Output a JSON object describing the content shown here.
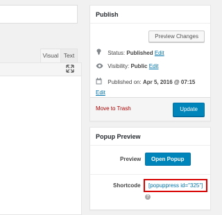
{
  "editor": {
    "tabs": {
      "visual": "Visual",
      "text": "Text"
    },
    "expand_icon": "fullscreen-icon"
  },
  "publish": {
    "title": "Publish",
    "preview_label": "Preview Changes",
    "status_label": "Status:",
    "status_value": "Published",
    "visibility_label": "Visibility:",
    "visibility_value": "Public",
    "published_label": "Published on:",
    "published_value": "Apr 5, 2016 @ 07:15",
    "edit_label": "Edit",
    "trash_label": "Move to Trash",
    "update_label": "Update",
    "icons": {
      "status": "pin-icon",
      "visibility": "eye-icon",
      "date": "calendar-icon"
    }
  },
  "popup_preview": {
    "title": "Popup Preview",
    "preview_label": "Preview",
    "open_button": "Open Popup",
    "shortcode_label": "Shortcode",
    "shortcode_value": "[popuppress id=\"325\"]",
    "help_icon": "?"
  },
  "colors": {
    "primary": "#0085ba",
    "link": "#0073aa",
    "trash": "#a00",
    "highlight_border": "#d90000"
  }
}
